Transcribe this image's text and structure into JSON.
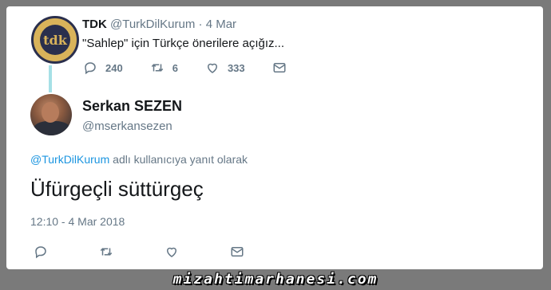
{
  "parent_tweet": {
    "name": "TDK",
    "handle": "@TurkDilKurum",
    "separator": "·",
    "time": "4 Mar",
    "text": "\"Sahlep\" için Türkçe önerilere açığız...",
    "avatar_text": "tdk",
    "replies": "240",
    "retweets": "6",
    "likes": "333"
  },
  "main_tweet": {
    "name": "Serkan SEZEN",
    "handle": "@mserkansezen",
    "reply_to_link": "@TurkDilKurum",
    "reply_to_suffix": " adlı kullanıcıya yanıt olarak",
    "text": "Üfürgeçli süttürgeç",
    "timestamp": "12:10 - 4 Mar 2018"
  },
  "watermark": "mizahtimarhanesi.com",
  "colors": {
    "link": "#1b95e0",
    "muted": "#657786",
    "thread_line": "#a6e0e6"
  },
  "icons": [
    "reply-icon",
    "retweet-icon",
    "like-icon",
    "message-icon"
  ]
}
